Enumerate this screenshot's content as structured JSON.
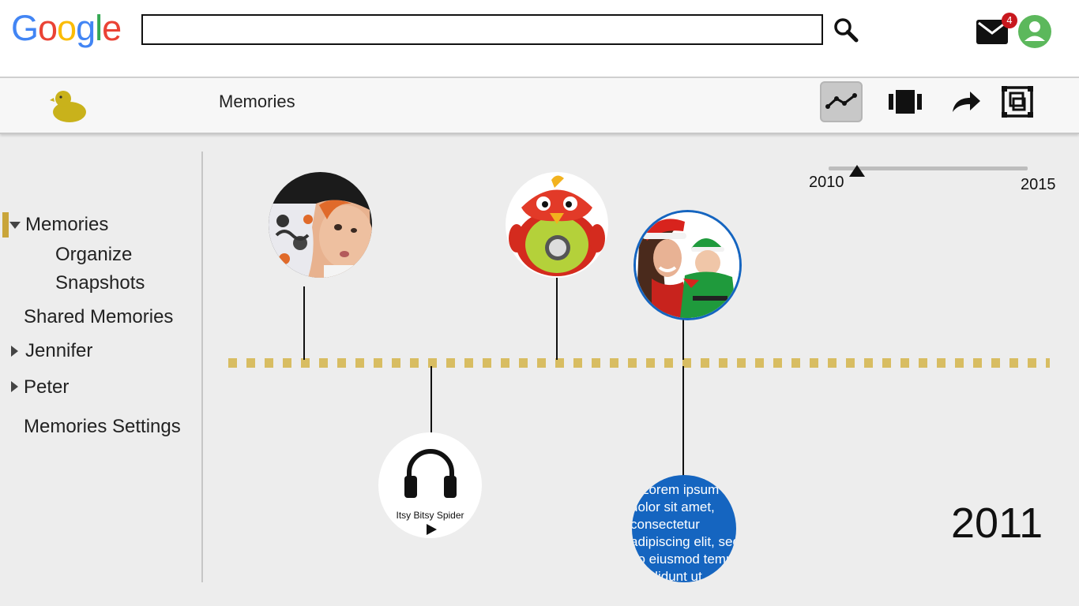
{
  "header": {
    "logo_letters": [
      "G",
      "o",
      "o",
      "g",
      "l",
      "e"
    ],
    "logo_colors": [
      "#4285f4",
      "#ea4335",
      "#fbbc05",
      "#4285f4",
      "#34a853",
      "#ea4335"
    ],
    "search": {
      "value": "",
      "placeholder": ""
    },
    "mail_badge_count": "4",
    "icons": [
      "search-icon",
      "mail-icon",
      "account-avatar-icon"
    ]
  },
  "appbar": {
    "title": "Memories",
    "toolbar_icons": [
      "timeline-view-icon",
      "carousel-view-icon",
      "share-icon",
      "fullscreen-icon"
    ],
    "active_tool": "timeline-view-icon",
    "duck_color": "#c9b21b"
  },
  "sidebar": {
    "items": [
      {
        "label": "Memories",
        "expanded": true,
        "selected": true
      },
      {
        "label": "Organize"
      },
      {
        "label": "Snapshots"
      },
      {
        "label": "Shared Memories"
      },
      {
        "label": "Jennifer",
        "expanded": false
      },
      {
        "label": "Peter",
        "expanded": false
      },
      {
        "label": "Memories Settings"
      }
    ],
    "accent_color": "#c9a53a"
  },
  "timeline": {
    "range_start": "2010",
    "range_end": "2015",
    "current_year": "2011",
    "line_color": "#d8bd62",
    "audio_memory": {
      "title": "Itsy Bitsy Spider",
      "icon": "headphones-icon"
    },
    "note_memory": {
      "text": "Lorem ipsum dolor sit amet, consectetur adipiscing elit, sed do eiusmod tempor incididunt ut"
    },
    "photo_memories": [
      "baby-photo",
      "toy-bird-photo",
      "mother-and-baby-photo"
    ],
    "note_color": "#1565c0"
  }
}
